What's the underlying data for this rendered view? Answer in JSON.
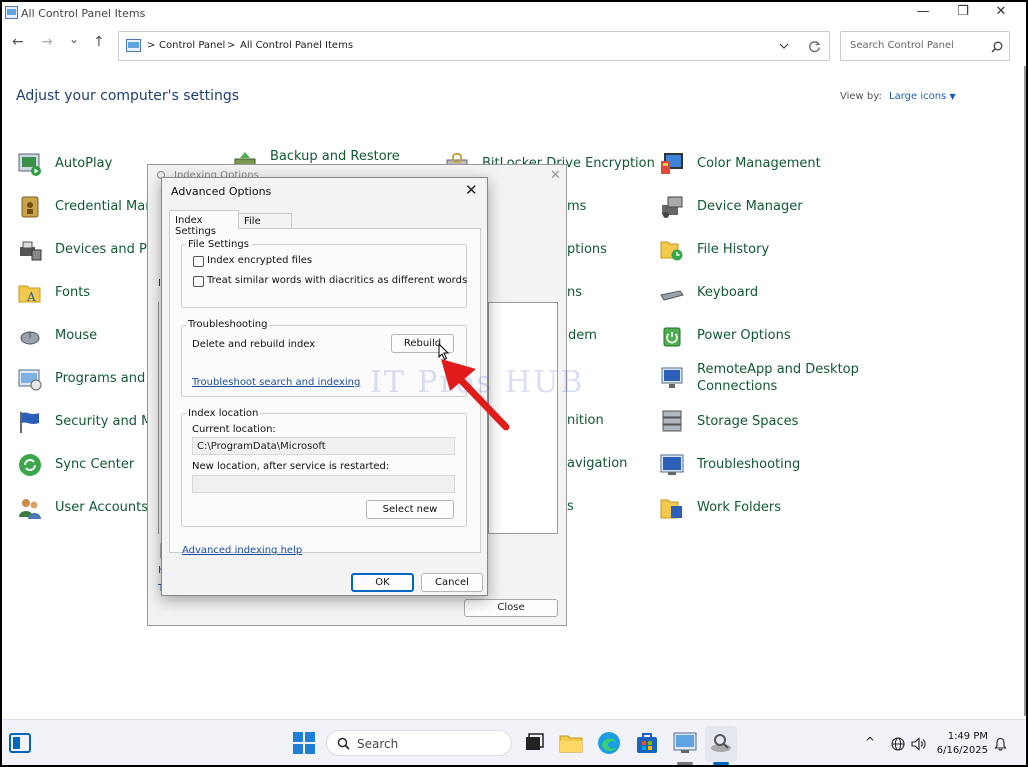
{
  "window": {
    "title": "All Control Panel Items",
    "minimize_glyph": "—",
    "maximize_glyph": "❐",
    "close_glyph": "✕"
  },
  "nav": {
    "back_glyph": "←",
    "forward_glyph": "→",
    "recent_glyph": "⌄",
    "up_glyph": "↑",
    "breadcrumb": [
      "Control Panel",
      "All Control Panel Items"
    ],
    "separator": ">",
    "search_placeholder": "Search Control Panel"
  },
  "header": {
    "title": "Adjust your computer's settings",
    "view_by_label": "View by:",
    "view_by_value": "Large icons"
  },
  "items": {
    "col1": [
      "AutoPlay",
      "Credential Mana",
      "Devices and Prin",
      "Fonts",
      "Mouse",
      "Programs and F",
      "Security and Ma",
      "Sync Center",
      "User Accounts"
    ],
    "col2_top": "Backup and Restore",
    "col3_top": "BitLocker Drive Encryption",
    "col3_partial": [
      "ms",
      "ptions",
      "ns",
      "dem",
      "nition",
      "avigation",
      "s"
    ],
    "col4": [
      "Color Management",
      "Device Manager",
      "File History",
      "Keyboard",
      "Power Options",
      "RemoteApp and Desktop",
      "Connections",
      "Storage Spaces",
      "Troubleshooting",
      "Work Folders"
    ]
  },
  "indexing_dialog": {
    "title": "Indexing Options",
    "close_button": "Close",
    "partial_letters": [
      "I",
      "H",
      "T"
    ]
  },
  "advanced_dialog": {
    "title": "Advanced Options",
    "tabs": [
      "Index Settings",
      "File Types"
    ],
    "file_settings": {
      "label": "File Settings",
      "options": [
        "Index encrypted files",
        "Treat similar words with diacritics as different words"
      ]
    },
    "troubleshooting": {
      "label": "Troubleshooting",
      "delete_rebuild_label": "Delete and rebuild index",
      "rebuild_button": "Rebuild",
      "troubleshoot_link": "Troubleshoot search and indexing"
    },
    "index_location": {
      "label": "Index location",
      "current_label": "Current location:",
      "current_value": "C:\\ProgramData\\Microsoft",
      "new_label": "New location, after service is restarted:",
      "new_value": "",
      "select_new_button": "Select new"
    },
    "help_link": "Advanced indexing help",
    "ok_button": "OK",
    "cancel_button": "Cancel"
  },
  "watermark": "IT Pros HUB",
  "taskbar": {
    "search_placeholder": "Search",
    "time": "1:49 PM",
    "date": "6/16/2025"
  },
  "colors": {
    "item_text": "#0f5a30",
    "heading": "#1e3f76",
    "link": "#1a4fa0",
    "arrow": "#e01b1b",
    "accent": "#0067c0"
  }
}
